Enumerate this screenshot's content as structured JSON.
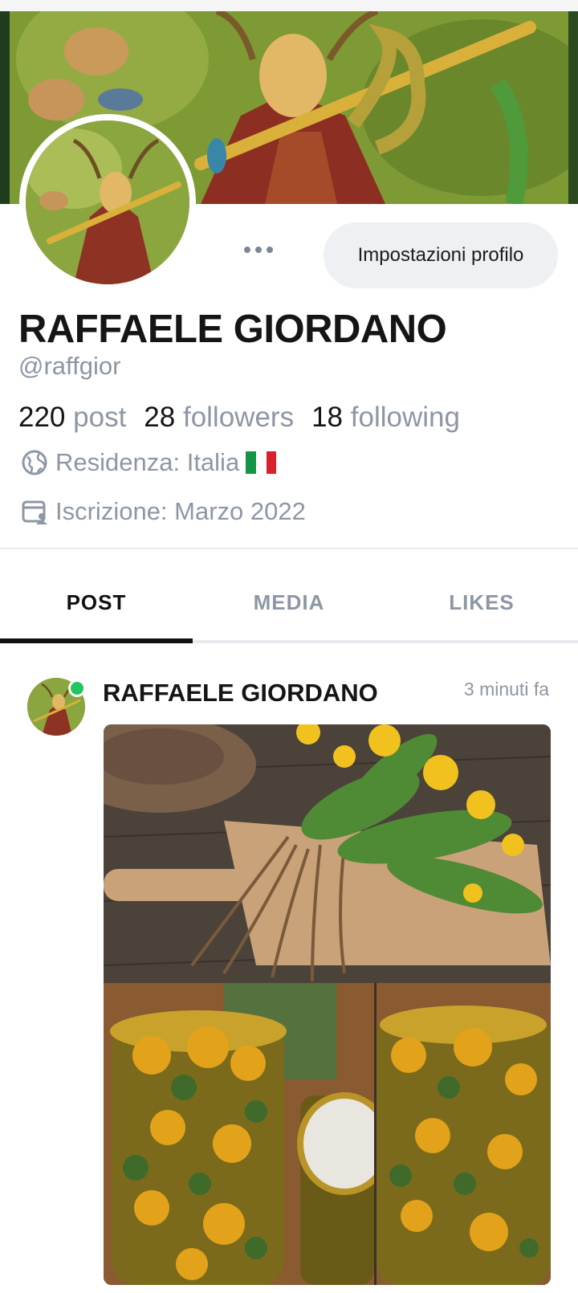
{
  "profile": {
    "display_name": "RAFFAELE GIORDANO",
    "handle": "@raffgior",
    "settings_label": "Impostazioni profilo",
    "stats": {
      "posts_count": "220",
      "posts_label": "post",
      "followers_count": "28",
      "followers_label": "followers",
      "following_count": "18",
      "following_label": "following"
    },
    "residence": "Residenza: Italia",
    "joined": "Iscrizione: Marzo 2022",
    "flag_colors": [
      "#159447",
      "#ffffff",
      "#d8202f"
    ]
  },
  "tabs": [
    {
      "label": "POST",
      "active": true
    },
    {
      "label": "MEDIA",
      "active": false
    },
    {
      "label": "LIKES",
      "active": false
    }
  ],
  "post": {
    "author": "RAFFAELE GIORDANO",
    "time": "3 minuti fa",
    "online": true
  },
  "icons": {
    "more": "more-horizontal-icon",
    "residence": "globe-icon",
    "joined": "calendar-user-icon"
  },
  "colors": {
    "muted_text": "#8d97a4",
    "button_bg": "#eef0f4",
    "online": "#22c55e",
    "tab_active": "#111111"
  }
}
